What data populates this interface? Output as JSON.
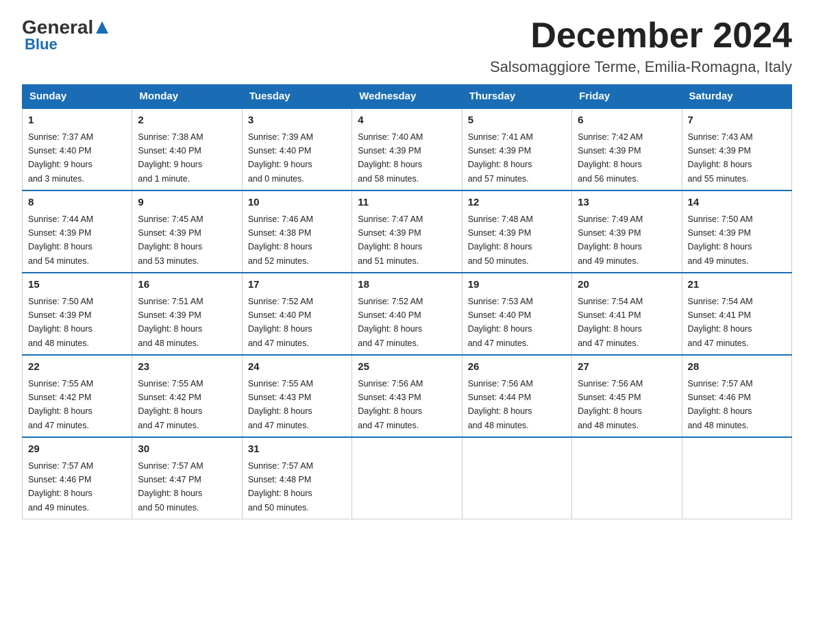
{
  "logo": {
    "general": "General",
    "blue": "Blue",
    "triangle": "▲"
  },
  "header": {
    "month_year": "December 2024",
    "location": "Salsomaggiore Terme, Emilia-Romagna, Italy"
  },
  "days_of_week": [
    "Sunday",
    "Monday",
    "Tuesday",
    "Wednesday",
    "Thursday",
    "Friday",
    "Saturday"
  ],
  "weeks": [
    [
      {
        "day": "1",
        "sunrise": "7:37 AM",
        "sunset": "4:40 PM",
        "daylight": "9 hours and 3 minutes."
      },
      {
        "day": "2",
        "sunrise": "7:38 AM",
        "sunset": "4:40 PM",
        "daylight": "9 hours and 1 minute."
      },
      {
        "day": "3",
        "sunrise": "7:39 AM",
        "sunset": "4:40 PM",
        "daylight": "9 hours and 0 minutes."
      },
      {
        "day": "4",
        "sunrise": "7:40 AM",
        "sunset": "4:39 PM",
        "daylight": "8 hours and 58 minutes."
      },
      {
        "day": "5",
        "sunrise": "7:41 AM",
        "sunset": "4:39 PM",
        "daylight": "8 hours and 57 minutes."
      },
      {
        "day": "6",
        "sunrise": "7:42 AM",
        "sunset": "4:39 PM",
        "daylight": "8 hours and 56 minutes."
      },
      {
        "day": "7",
        "sunrise": "7:43 AM",
        "sunset": "4:39 PM",
        "daylight": "8 hours and 55 minutes."
      }
    ],
    [
      {
        "day": "8",
        "sunrise": "7:44 AM",
        "sunset": "4:39 PM",
        "daylight": "8 hours and 54 minutes."
      },
      {
        "day": "9",
        "sunrise": "7:45 AM",
        "sunset": "4:39 PM",
        "daylight": "8 hours and 53 minutes."
      },
      {
        "day": "10",
        "sunrise": "7:46 AM",
        "sunset": "4:38 PM",
        "daylight": "8 hours and 52 minutes."
      },
      {
        "day": "11",
        "sunrise": "7:47 AM",
        "sunset": "4:39 PM",
        "daylight": "8 hours and 51 minutes."
      },
      {
        "day": "12",
        "sunrise": "7:48 AM",
        "sunset": "4:39 PM",
        "daylight": "8 hours and 50 minutes."
      },
      {
        "day": "13",
        "sunrise": "7:49 AM",
        "sunset": "4:39 PM",
        "daylight": "8 hours and 49 minutes."
      },
      {
        "day": "14",
        "sunrise": "7:50 AM",
        "sunset": "4:39 PM",
        "daylight": "8 hours and 49 minutes."
      }
    ],
    [
      {
        "day": "15",
        "sunrise": "7:50 AM",
        "sunset": "4:39 PM",
        "daylight": "8 hours and 48 minutes."
      },
      {
        "day": "16",
        "sunrise": "7:51 AM",
        "sunset": "4:39 PM",
        "daylight": "8 hours and 48 minutes."
      },
      {
        "day": "17",
        "sunrise": "7:52 AM",
        "sunset": "4:40 PM",
        "daylight": "8 hours and 47 minutes."
      },
      {
        "day": "18",
        "sunrise": "7:52 AM",
        "sunset": "4:40 PM",
        "daylight": "8 hours and 47 minutes."
      },
      {
        "day": "19",
        "sunrise": "7:53 AM",
        "sunset": "4:40 PM",
        "daylight": "8 hours and 47 minutes."
      },
      {
        "day": "20",
        "sunrise": "7:54 AM",
        "sunset": "4:41 PM",
        "daylight": "8 hours and 47 minutes."
      },
      {
        "day": "21",
        "sunrise": "7:54 AM",
        "sunset": "4:41 PM",
        "daylight": "8 hours and 47 minutes."
      }
    ],
    [
      {
        "day": "22",
        "sunrise": "7:55 AM",
        "sunset": "4:42 PM",
        "daylight": "8 hours and 47 minutes."
      },
      {
        "day": "23",
        "sunrise": "7:55 AM",
        "sunset": "4:42 PM",
        "daylight": "8 hours and 47 minutes."
      },
      {
        "day": "24",
        "sunrise": "7:55 AM",
        "sunset": "4:43 PM",
        "daylight": "8 hours and 47 minutes."
      },
      {
        "day": "25",
        "sunrise": "7:56 AM",
        "sunset": "4:43 PM",
        "daylight": "8 hours and 47 minutes."
      },
      {
        "day": "26",
        "sunrise": "7:56 AM",
        "sunset": "4:44 PM",
        "daylight": "8 hours and 48 minutes."
      },
      {
        "day": "27",
        "sunrise": "7:56 AM",
        "sunset": "4:45 PM",
        "daylight": "8 hours and 48 minutes."
      },
      {
        "day": "28",
        "sunrise": "7:57 AM",
        "sunset": "4:46 PM",
        "daylight": "8 hours and 48 minutes."
      }
    ],
    [
      {
        "day": "29",
        "sunrise": "7:57 AM",
        "sunset": "4:46 PM",
        "daylight": "8 hours and 49 minutes."
      },
      {
        "day": "30",
        "sunrise": "7:57 AM",
        "sunset": "4:47 PM",
        "daylight": "8 hours and 50 minutes."
      },
      {
        "day": "31",
        "sunrise": "7:57 AM",
        "sunset": "4:48 PM",
        "daylight": "8 hours and 50 minutes."
      },
      null,
      null,
      null,
      null
    ]
  ],
  "labels": {
    "sunrise": "Sunrise:",
    "sunset": "Sunset:",
    "daylight": "Daylight:"
  }
}
